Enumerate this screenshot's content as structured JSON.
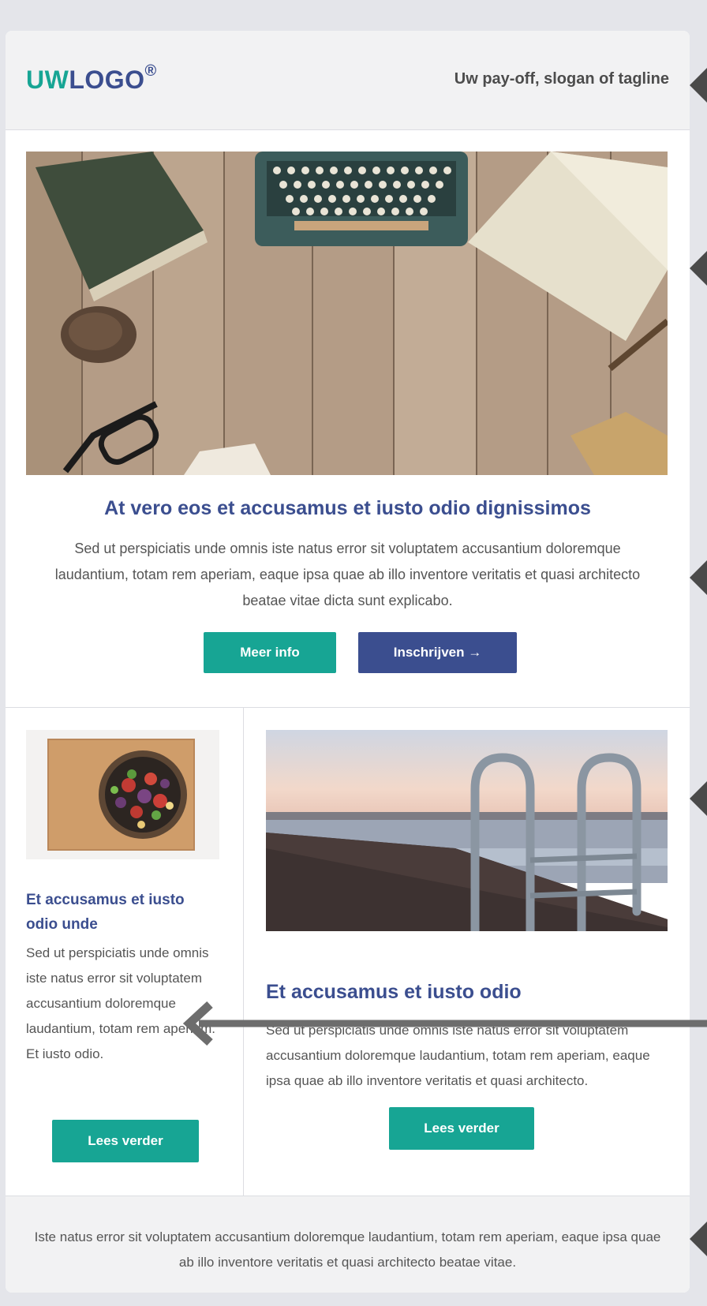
{
  "header": {
    "logo_part1": "UW",
    "logo_part2": "LOGO",
    "logo_mark": "®",
    "tagline": "Uw pay-off, slogan of tagline"
  },
  "hero": {
    "image": "desk-flatlay-typewriter-image",
    "title": "At vero eos et accusamus et iusto odio dignissimos",
    "text": "Sed ut perspiciatis unde omnis iste natus error sit voluptatem accusantium doloremque laudantium, totam rem aperiam, eaque ipsa quae ab illo inventore veritatis et quasi architecto beatae vitae dicta sunt explicabo.",
    "primary_button": "Meer info",
    "secondary_button": "Inschrijven →"
  },
  "columns": {
    "left": {
      "image": "salad-bowl-image",
      "title": "Et accusamus et iusto odio unde",
      "text": "Sed ut perspiciatis unde omnis iste natus error sit voluptatem accusantium doloremque laudantium, totam rem aperiam. Et iusto odio.",
      "button": "Lees verder"
    },
    "right": {
      "image": "pier-ladder-lake-image",
      "title": "Et accusamus et iusto odio",
      "text": "Sed ut perspiciatis unde omnis iste natus error sit voluptatem accusantium doloremque laudantium, totam rem aperiam, eaque ipsa quae ab illo inventore veritatis et quasi architecto.",
      "button": "Lees verder"
    }
  },
  "footer": {
    "text": "Iste natus error sit voluptatem accusantium doloremque laudantium, totam rem aperiam, eaque ipsa quae ab illo inventore veritatis et quasi architecto beatae vitae."
  },
  "colors": {
    "accent_teal": "#17a594",
    "brand_blue": "#3b4e8f",
    "page_background": "#e4e5ea",
    "annotation_arrow": "#6d6d6d"
  }
}
